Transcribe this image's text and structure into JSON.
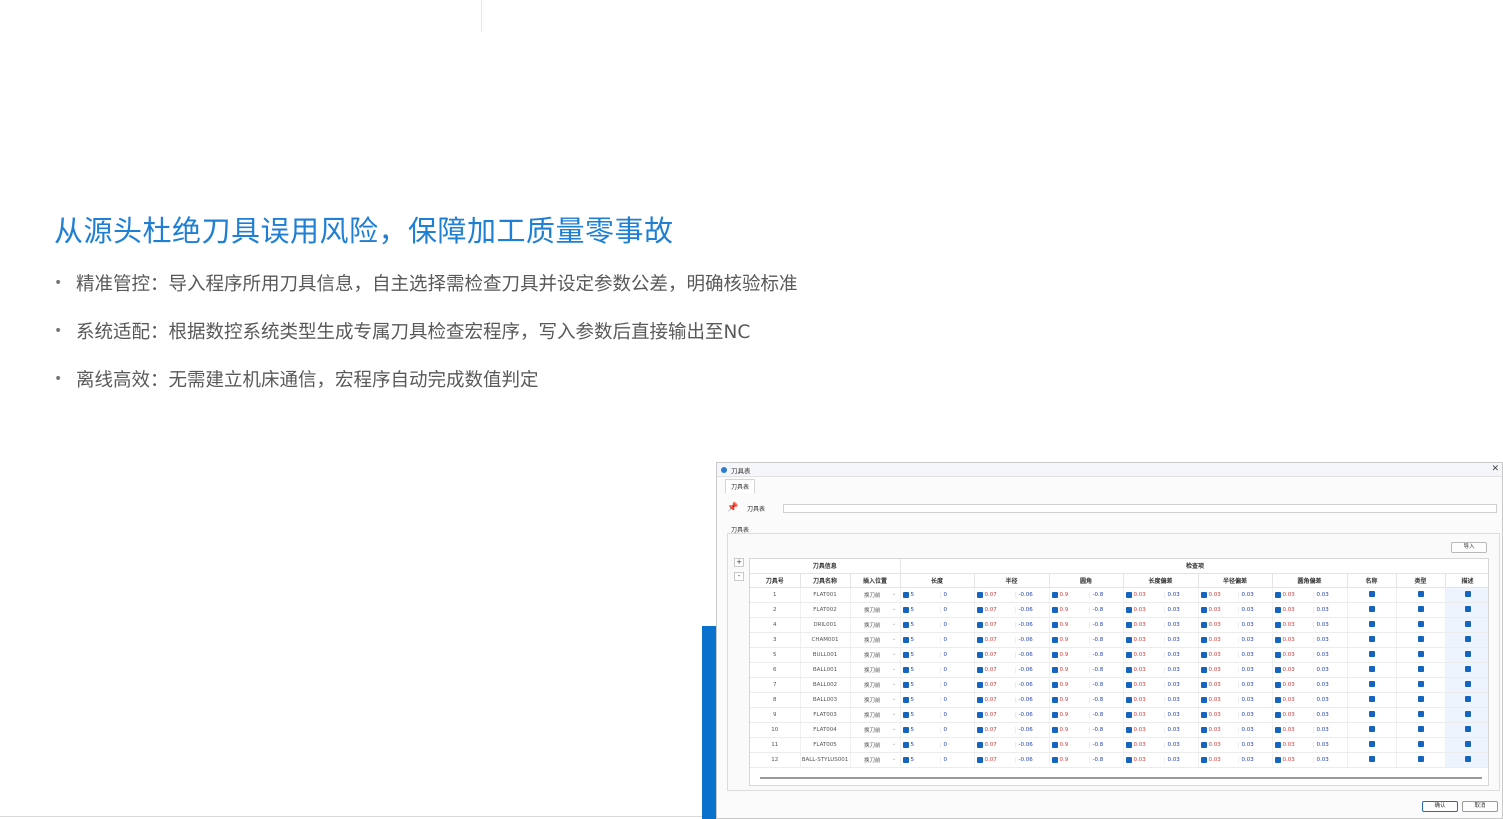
{
  "headline": "从源头杜绝刀具误用风险，保障加工质量零事故",
  "bullets": [
    "精准管控：导入程序所用刀具信息，自主选择需检查刀具并设定参数公差，明确核验标准",
    "系统适配：根据数控系统类型生成专属刀具检查宏程序，写入参数后直接输出至NC",
    "离线高效：无需建立机床通信，宏程序自动完成数值判定"
  ],
  "dialog": {
    "title": "刀具表",
    "tab": "刀具表",
    "path_label": "刀具表",
    "group_label": "刀具表",
    "import_label": "导入",
    "add_label": "+",
    "remove_label": "-",
    "confirm_label": "确认",
    "cancel_label": "取消",
    "header_groups": {
      "info": "刀具信息",
      "check": "检查项"
    },
    "columns": [
      "刀具号",
      "刀具名称",
      "插入位置",
      "长度",
      "半径",
      "圆角",
      "长度偏差",
      "半径偏差",
      "圆角偏差",
      "名称",
      "类型",
      "描述"
    ],
    "rows": [
      {
        "no": "1",
        "name": "FLAT001",
        "slot": "换刀前",
        "len": "5",
        "len2": "0",
        "rad": "0.07",
        "rad2": "-0.06",
        "cor": "0.9",
        "cor2": "-0.8",
        "ld": "0.03",
        "ld2": "0.03",
        "rd": "0.03",
        "rd2": "0.03",
        "cd": "0.03",
        "cd2": "0.03"
      },
      {
        "no": "2",
        "name": "FLAT002",
        "slot": "换刀前",
        "len": "5",
        "len2": "0",
        "rad": "0.07",
        "rad2": "-0.06",
        "cor": "0.9",
        "cor2": "-0.8",
        "ld": "0.03",
        "ld2": "0.03",
        "rd": "0.03",
        "rd2": "0.03",
        "cd": "0.03",
        "cd2": "0.03"
      },
      {
        "no": "4",
        "name": "DRIL001",
        "slot": "换刀前",
        "len": "5",
        "len2": "0",
        "rad": "0.07",
        "rad2": "-0.06",
        "cor": "0.9",
        "cor2": "-0.8",
        "ld": "0.03",
        "ld2": "0.03",
        "rd": "0.03",
        "rd2": "0.03",
        "cd": "0.03",
        "cd2": "0.03"
      },
      {
        "no": "3",
        "name": "CHAM001",
        "slot": "换刀前",
        "len": "5",
        "len2": "0",
        "rad": "0.07",
        "rad2": "-0.06",
        "cor": "0.9",
        "cor2": "-0.8",
        "ld": "0.03",
        "ld2": "0.03",
        "rd": "0.03",
        "rd2": "0.03",
        "cd": "0.03",
        "cd2": "0.03"
      },
      {
        "no": "5",
        "name": "BULL001",
        "slot": "换刀前",
        "len": "5",
        "len2": "0",
        "rad": "0.07",
        "rad2": "-0.06",
        "cor": "0.9",
        "cor2": "-0.8",
        "ld": "0.03",
        "ld2": "0.03",
        "rd": "0.03",
        "rd2": "0.03",
        "cd": "0.03",
        "cd2": "0.03"
      },
      {
        "no": "6",
        "name": "BALL001",
        "slot": "换刀前",
        "len": "5",
        "len2": "0",
        "rad": "0.07",
        "rad2": "-0.06",
        "cor": "0.9",
        "cor2": "-0.8",
        "ld": "0.03",
        "ld2": "0.03",
        "rd": "0.03",
        "rd2": "0.03",
        "cd": "0.03",
        "cd2": "0.03"
      },
      {
        "no": "7",
        "name": "BALL002",
        "slot": "换刀前",
        "len": "5",
        "len2": "0",
        "rad": "0.07",
        "rad2": "-0.06",
        "cor": "0.9",
        "cor2": "-0.8",
        "ld": "0.03",
        "ld2": "0.03",
        "rd": "0.03",
        "rd2": "0.03",
        "cd": "0.03",
        "cd2": "0.03"
      },
      {
        "no": "8",
        "name": "BALL003",
        "slot": "换刀前",
        "len": "5",
        "len2": "0",
        "rad": "0.07",
        "rad2": "-0.06",
        "cor": "0.9",
        "cor2": "-0.8",
        "ld": "0.03",
        "ld2": "0.03",
        "rd": "0.03",
        "rd2": "0.03",
        "cd": "0.03",
        "cd2": "0.03"
      },
      {
        "no": "9",
        "name": "FLAT003",
        "slot": "换刀前",
        "len": "5",
        "len2": "0",
        "rad": "0.07",
        "rad2": "-0.06",
        "cor": "0.9",
        "cor2": "-0.8",
        "ld": "0.03",
        "ld2": "0.03",
        "rd": "0.03",
        "rd2": "0.03",
        "cd": "0.03",
        "cd2": "0.03"
      },
      {
        "no": "10",
        "name": "FLAT004",
        "slot": "换刀前",
        "len": "5",
        "len2": "0",
        "rad": "0.07",
        "rad2": "-0.06",
        "cor": "0.9",
        "cor2": "-0.8",
        "ld": "0.03",
        "ld2": "0.03",
        "rd": "0.03",
        "rd2": "0.03",
        "cd": "0.03",
        "cd2": "0.03"
      },
      {
        "no": "11",
        "name": "FLAT005",
        "slot": "换刀前",
        "len": "5",
        "len2": "0",
        "rad": "0.07",
        "rad2": "-0.06",
        "cor": "0.9",
        "cor2": "-0.8",
        "ld": "0.03",
        "ld2": "0.03",
        "rd": "0.03",
        "rd2": "0.03",
        "cd": "0.03",
        "cd2": "0.03"
      },
      {
        "no": "12",
        "name": "BALL-STYLUS001",
        "slot": "换刀前",
        "len": "5",
        "len2": "0",
        "rad": "0.07",
        "rad2": "-0.06",
        "cor": "0.9",
        "cor2": "-0.8",
        "ld": "0.03",
        "ld2": "0.03",
        "rd": "0.03",
        "rd2": "0.03",
        "cd": "0.03",
        "cd2": "0.03"
      }
    ]
  },
  "colors": {
    "headline": "#1f7fd4",
    "accent_bar": "#0a72cc",
    "checkbox": "#1565c0",
    "value_red": "#d23a3a",
    "value_blue": "#1f3fb0"
  },
  "icons": {
    "bullet": "bullet-dot",
    "pin": "pin-icon",
    "app": "app-icon",
    "close": "close-icon",
    "checkbox": "checkbox-checked-icon"
  }
}
